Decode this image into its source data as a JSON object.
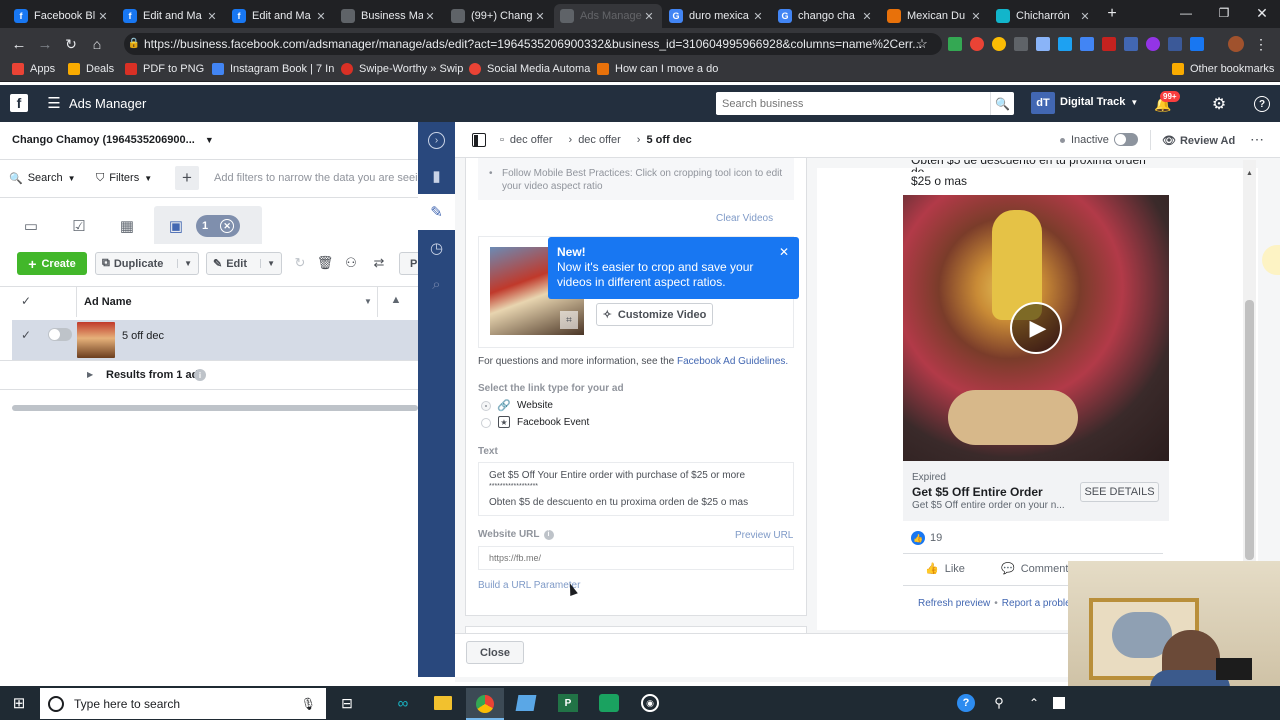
{
  "browser": {
    "tabs": [
      {
        "title": "Facebook Bl",
        "icon": "facebook-icon",
        "color": "#1877f2"
      },
      {
        "title": "Edit and Ma",
        "icon": "facebook-icon",
        "color": "#1877f2"
      },
      {
        "title": "Edit and Ma",
        "icon": "facebook-icon",
        "color": "#1877f2"
      },
      {
        "title": "Business Ma",
        "icon": "page-icon",
        "color": "#5f6368"
      },
      {
        "title": "(99+) Chang",
        "icon": "page-icon",
        "color": "#5f6368"
      },
      {
        "title": "Ads Manager",
        "icon": "page-icon",
        "color": "#5f6368",
        "active": true
      },
      {
        "title": "duro mexica",
        "icon": "google-icon",
        "color": "#4285f4"
      },
      {
        "title": "chango cha",
        "icon": "google-icon",
        "color": "#4285f4"
      },
      {
        "title": "Mexican Du",
        "icon": "page-icon",
        "color": "#e8710a"
      },
      {
        "title": "Chicharrón",
        "icon": "page-icon",
        "color": "#12b5cb"
      }
    ],
    "url": "https://business.facebook.com/adsmanager/manage/ads/edit?act=1964535206900332&business_id=310604995966928&columns=name%2Cerr...",
    "bookmarks": [
      "Apps",
      "Deals",
      "PDF to PNG",
      "Instagram Book | 7 In",
      "Swipe-Worthy » Swip",
      "Social Media Automa",
      "How can I move a do",
      "Other bookmarks"
    ]
  },
  "header": {
    "app_title": "Ads Manager",
    "search_placeholder": "Search business",
    "account_name": "Digital Track",
    "notif_badge": "99+"
  },
  "left": {
    "account": "Chango Chamoy (1964535206900...",
    "search_label": "Search",
    "filters_label": "Filters",
    "filter_placeholder": "Add filters to narrow the data you are seeing",
    "selected_count": "1",
    "create_label": "Create",
    "duplicate_label": "Duplicate",
    "edit_label": "Edit",
    "cut_label": "P",
    "col_ad_name": "Ad Name",
    "row_name": "5 off dec",
    "results_label": "Results from 1 ad"
  },
  "editor": {
    "breadcrumbs": [
      "dec offer",
      "dec offer",
      "5 off dec"
    ],
    "status": "Inactive",
    "review_label": "Review Ad",
    "best_practice": "Follow Mobile Best Practices: Click on cropping tool icon to edit your video aspect ratio",
    "clear_videos": "Clear Videos",
    "tooltip_title": "New!",
    "tooltip_body": "Now it's easier to crop and save your videos in different aspect ratios.",
    "customize_video": "Customize Video",
    "guidelines_prefix": "For questions and more information, see the",
    "guidelines_link": "Facebook Ad Guidelines.",
    "link_type_label": "Select the link type for your ad",
    "option_website": "Website",
    "option_event": "Facebook Event",
    "text_label": "Text",
    "text_line1": "Get $5 Off Your Entire order with purchase of $25 or more",
    "text_line2": "******************",
    "text_line3": "Obten $5 de descuento en tu proxima orden de $25 o mas",
    "website_url_label": "Website URL",
    "preview_url": "Preview URL",
    "url_placeholder": "https://fb.me/",
    "build_param": "Build a URL Parameter",
    "close_label": "Close"
  },
  "preview": {
    "top_text_1": "Obten $5 de descuento en tu proxima orden de",
    "top_text_2": "$25 o mas",
    "expired": "Expired",
    "headline": "Get $5 Off Entire Order",
    "desc": "Get $5 Off entire order on your n...",
    "see_details": "SEE DETAILS",
    "likes": "19",
    "like_label": "Like",
    "comment_label": "Comment",
    "refresh": "Refresh preview",
    "report": "Report a problem"
  },
  "taskbar": {
    "search_placeholder": "Type here to search"
  }
}
